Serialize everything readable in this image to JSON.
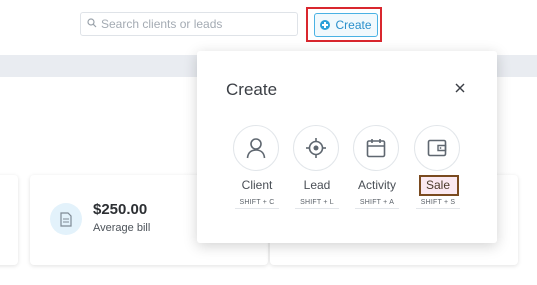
{
  "search": {
    "placeholder": "Search clients or leads",
    "icon": "search-icon"
  },
  "header": {
    "create_label": "Create",
    "create_icon": "plus-circle-icon"
  },
  "cards": [
    {
      "amount": "$250.00",
      "label": "Average bill",
      "icon": "document-icon"
    }
  ],
  "modal": {
    "title": "Create",
    "close_icon": "close-icon",
    "options": [
      {
        "label": "Client",
        "shortcut": "SHIFT + C",
        "icon": "user-icon"
      },
      {
        "label": "Lead",
        "shortcut": "SHIFT + L",
        "icon": "crosshair-icon"
      },
      {
        "label": "Activity",
        "shortcut": "SHIFT + A",
        "icon": "calendar-icon"
      },
      {
        "label": "Sale",
        "shortcut": "SHIFT + S",
        "icon": "wallet-icon"
      }
    ]
  },
  "colors": {
    "accent": "#2a9fd8",
    "highlight_red": "#d9272e",
    "highlight_brown": "#7a4a1f"
  }
}
